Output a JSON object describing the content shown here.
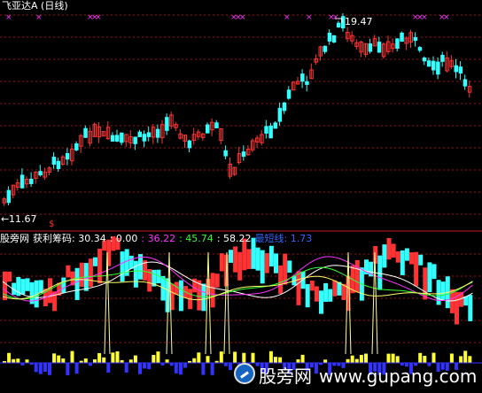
{
  "header": {
    "title": "飞亚达A (日线)",
    "high_label": "19.47",
    "low_label": "11.67",
    "low_arrow": "←"
  },
  "indicator": {
    "name": "股旁网",
    "main_label": "获利筹码:",
    "values": [
      {
        "text": "获利筹码: 30.34",
        "color": "#ffffff"
      },
      {
        "text": ": 0.00",
        "color": "#ffffff"
      },
      {
        "text": ": 36.22",
        "color": "#ff33ff"
      },
      {
        "text": ": 45.74",
        "color": "#33ff33"
      },
      {
        "text": ": 58.22",
        "color": "#ffffff"
      },
      {
        "text": "最短线: 1.73",
        "color": "#3366ff"
      }
    ]
  },
  "watermark": {
    "text": "股旁网",
    "url": "www.gupang.com"
  },
  "colors": {
    "up": "#ff3333",
    "down": "#33ffff",
    "grid": "#a01010",
    "marker": "#ff33ff",
    "vol_up": "#ffff33",
    "vol_down": "#3333ff"
  },
  "chart_data": {
    "type": "candlestick",
    "price_range": [
      11.0,
      20.2
    ],
    "high_value": 19.47,
    "low_value": 11.67,
    "marker_symbol": "×",
    "signal_symbol": "$"
  }
}
